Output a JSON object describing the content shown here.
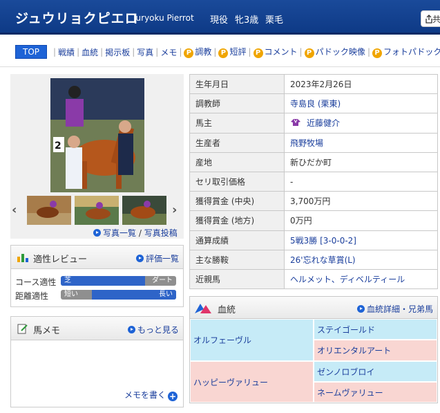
{
  "header": {
    "name": "ジュウリョクピエロ",
    "romaji": "Juryoku Pierrot",
    "status": "現役",
    "sex_age": "牝3歳",
    "coat": "栗毛",
    "share_label": "共"
  },
  "nav": {
    "items": [
      {
        "label": "TOP",
        "active": true,
        "premium": false
      },
      {
        "label": "戦績",
        "premium": false
      },
      {
        "label": "血統",
        "premium": false
      },
      {
        "label": "掲示板",
        "premium": false
      },
      {
        "label": "写真",
        "premium": false
      },
      {
        "label": "メモ",
        "premium": false
      },
      {
        "label": "調教",
        "premium": true
      },
      {
        "label": "短評",
        "premium": true
      },
      {
        "label": "コメント",
        "premium": true
      },
      {
        "label": "パドック映像",
        "premium": true
      },
      {
        "label": "フォトパドック",
        "premium": true
      }
    ],
    "premium_badge": "P"
  },
  "photos": {
    "list_link": "写真一覧",
    "divider": "/",
    "post_link": "写真投稿",
    "prev_icon": "‹",
    "next_icon": "›"
  },
  "aptitude": {
    "title": "適性レビュー",
    "link": "評価一覧",
    "course": {
      "label": "コース適性",
      "left": "芝",
      "right": "ダート",
      "level": 0.73
    },
    "distance": {
      "label": "距離適性",
      "left": "短い",
      "right": "長い",
      "level": 0.27
    }
  },
  "memo": {
    "title": "馬メモ",
    "more_link": "もっと見る",
    "write_link": "メモを書く",
    "plus_icon": "+"
  },
  "profile": [
    {
      "key": "生年月日",
      "value": "2023年2月26日",
      "link": false
    },
    {
      "key": "調教師",
      "value": "寺島良 (栗東)",
      "link": true
    },
    {
      "key": "馬主",
      "value": "近藤健介",
      "link": true,
      "silks": true
    },
    {
      "key": "生産者",
      "value": "飛野牧場",
      "link": true
    },
    {
      "key": "産地",
      "value": "新ひだか町",
      "link": false
    },
    {
      "key": "セリ取引価格",
      "value": "-",
      "link": false
    },
    {
      "key": "獲得賞金 (中央)",
      "value": "3,700万円",
      "link": false
    },
    {
      "key": "獲得賞金 (地方)",
      "value": "0万円",
      "link": false
    },
    {
      "key": "通算成績",
      "value": "5戦3勝 [3-0-0-2]",
      "link": true
    },
    {
      "key": "主な勝鞍",
      "value": "26'忘れな草賞(L)",
      "link": true
    },
    {
      "key": "近親馬",
      "value": "ヘルメット、ディベルティール",
      "link": true
    }
  ],
  "pedigree": {
    "title": "血統",
    "link": "血統詳細・兄弟馬",
    "sire": "オルフェーヴル",
    "sire_sire": "ステイゴールド",
    "sire_dam": "オリエンタルアート",
    "dam": "ハッピーヴァリュー",
    "dam_sire": "ゼンノロブロイ",
    "dam_dam": "ネームヴァリュー"
  }
}
